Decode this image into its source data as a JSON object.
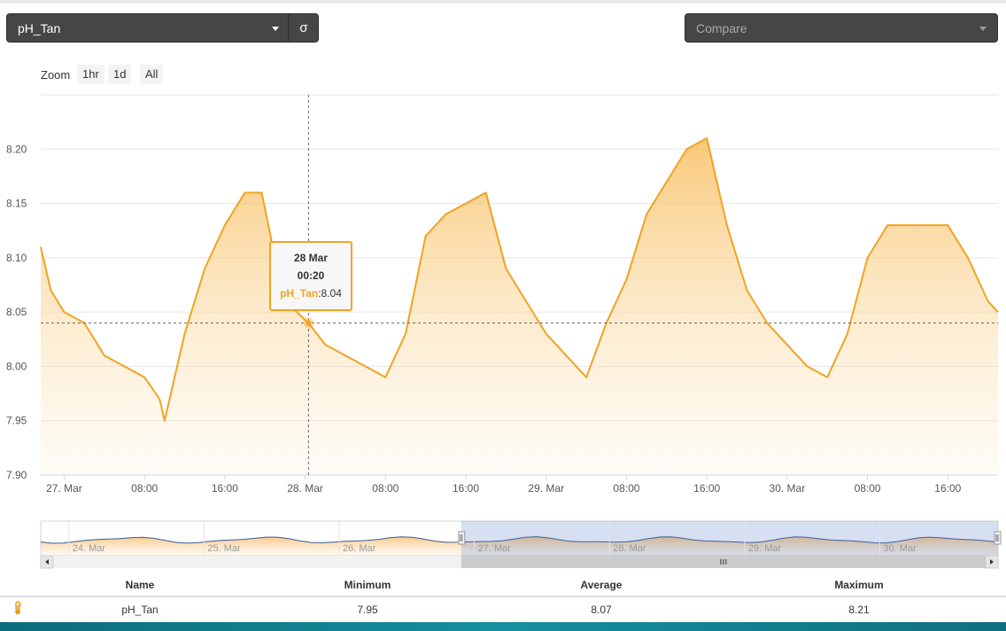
{
  "controls": {
    "metric_select": "pH_Tan",
    "sigma_button": "σ",
    "compare_placeholder": "Compare"
  },
  "zoom": {
    "label": "Zoom",
    "buttons": [
      "1hr",
      "1d",
      "All"
    ]
  },
  "chart_data": {
    "type": "area",
    "series": [
      {
        "name": "pH_Tan",
        "color": "#f0a323"
      }
    ],
    "x": [
      "2025-03-26T21:40",
      "2025-03-26T22:40",
      "2025-03-27T00:00",
      "2025-03-27T02:00",
      "2025-03-27T04:00",
      "2025-03-27T06:00",
      "2025-03-27T08:00",
      "2025-03-27T09:30",
      "2025-03-27T10:00",
      "2025-03-27T12:00",
      "2025-03-27T14:00",
      "2025-03-27T16:00",
      "2025-03-27T18:00",
      "2025-03-27T19:40",
      "2025-03-27T21:00",
      "2025-03-27T22:00",
      "2025-03-28T00:20",
      "2025-03-28T02:00",
      "2025-03-28T04:00",
      "2025-03-28T06:00",
      "2025-03-28T08:00",
      "2025-03-28T10:00",
      "2025-03-28T12:00",
      "2025-03-28T14:00",
      "2025-03-28T16:00",
      "2025-03-28T18:00",
      "2025-03-28T20:00",
      "2025-03-28T22:00",
      "2025-03-29T00:00",
      "2025-03-29T02:00",
      "2025-03-29T04:00",
      "2025-03-29T06:00",
      "2025-03-29T08:00",
      "2025-03-29T10:00",
      "2025-03-29T12:00",
      "2025-03-29T14:00",
      "2025-03-29T16:00",
      "2025-03-29T18:00",
      "2025-03-29T20:00",
      "2025-03-29T22:00",
      "2025-03-30T00:00",
      "2025-03-30T02:00",
      "2025-03-30T04:00",
      "2025-03-30T06:00",
      "2025-03-30T08:00",
      "2025-03-30T10:00",
      "2025-03-30T12:00",
      "2025-03-30T14:00",
      "2025-03-30T16:00",
      "2025-03-30T18:00",
      "2025-03-30T20:00",
      "2025-03-30T21:00"
    ],
    "values": [
      8.11,
      8.07,
      8.05,
      8.04,
      8.01,
      8.0,
      7.99,
      7.97,
      7.95,
      8.03,
      8.09,
      8.13,
      8.16,
      8.16,
      8.1,
      8.06,
      8.04,
      8.02,
      8.01,
      8.0,
      7.99,
      8.03,
      8.12,
      8.14,
      8.15,
      8.16,
      8.09,
      8.06,
      8.03,
      8.01,
      7.99,
      8.04,
      8.08,
      8.14,
      8.17,
      8.2,
      8.21,
      8.13,
      8.07,
      8.04,
      8.02,
      8.0,
      7.99,
      8.03,
      8.1,
      8.13,
      8.13,
      8.13,
      8.13,
      8.1,
      8.06,
      8.05
    ],
    "ylim": [
      7.9,
      8.25
    ],
    "yticks": [
      "7.90",
      "7.95",
      "8.00",
      "8.05",
      "8.10",
      "8.15",
      "8.20"
    ],
    "xticks": [
      "27. Mar",
      "08:00",
      "16:00",
      "28. Mar",
      "08:00",
      "16:00",
      "29. Mar",
      "08:00",
      "16:00",
      "30. Mar",
      "08:00",
      "16:00"
    ],
    "xtick_times": [
      "2025-03-27T00:00",
      "2025-03-27T08:00",
      "2025-03-27T16:00",
      "2025-03-28T00:00",
      "2025-03-28T08:00",
      "2025-03-28T16:00",
      "2025-03-29T00:00",
      "2025-03-29T08:00",
      "2025-03-29T16:00",
      "2025-03-30T00:00",
      "2025-03-30T08:00",
      "2025-03-30T16:00"
    ],
    "xlim": [
      "2025-03-26T21:40",
      "2025-03-30T21:00"
    ],
    "grid": true,
    "crosshair": {
      "x": "2025-03-28T00:20",
      "y": 8.04
    },
    "navigator": {
      "labels": [
        "24. Mar",
        "25. Mar",
        "26. Mar",
        "27. Mar",
        "28. Mar",
        "29. Mar",
        "30. Mar"
      ],
      "selected_range": [
        "2025-03-26T21:40",
        "2025-03-30T21:00"
      ]
    }
  },
  "tooltip": {
    "date": "28 Mar",
    "time": "00:20",
    "series_name": "pH_Tan",
    "value": "8.04"
  },
  "stats_table": {
    "headers": [
      "Name",
      "Minimum",
      "Average",
      "Maximum"
    ],
    "rows": [
      {
        "name": "pH_Tan",
        "minimum": "7.95",
        "average": "8.07",
        "maximum": "8.21",
        "icon": "thermometer-icon"
      }
    ]
  }
}
